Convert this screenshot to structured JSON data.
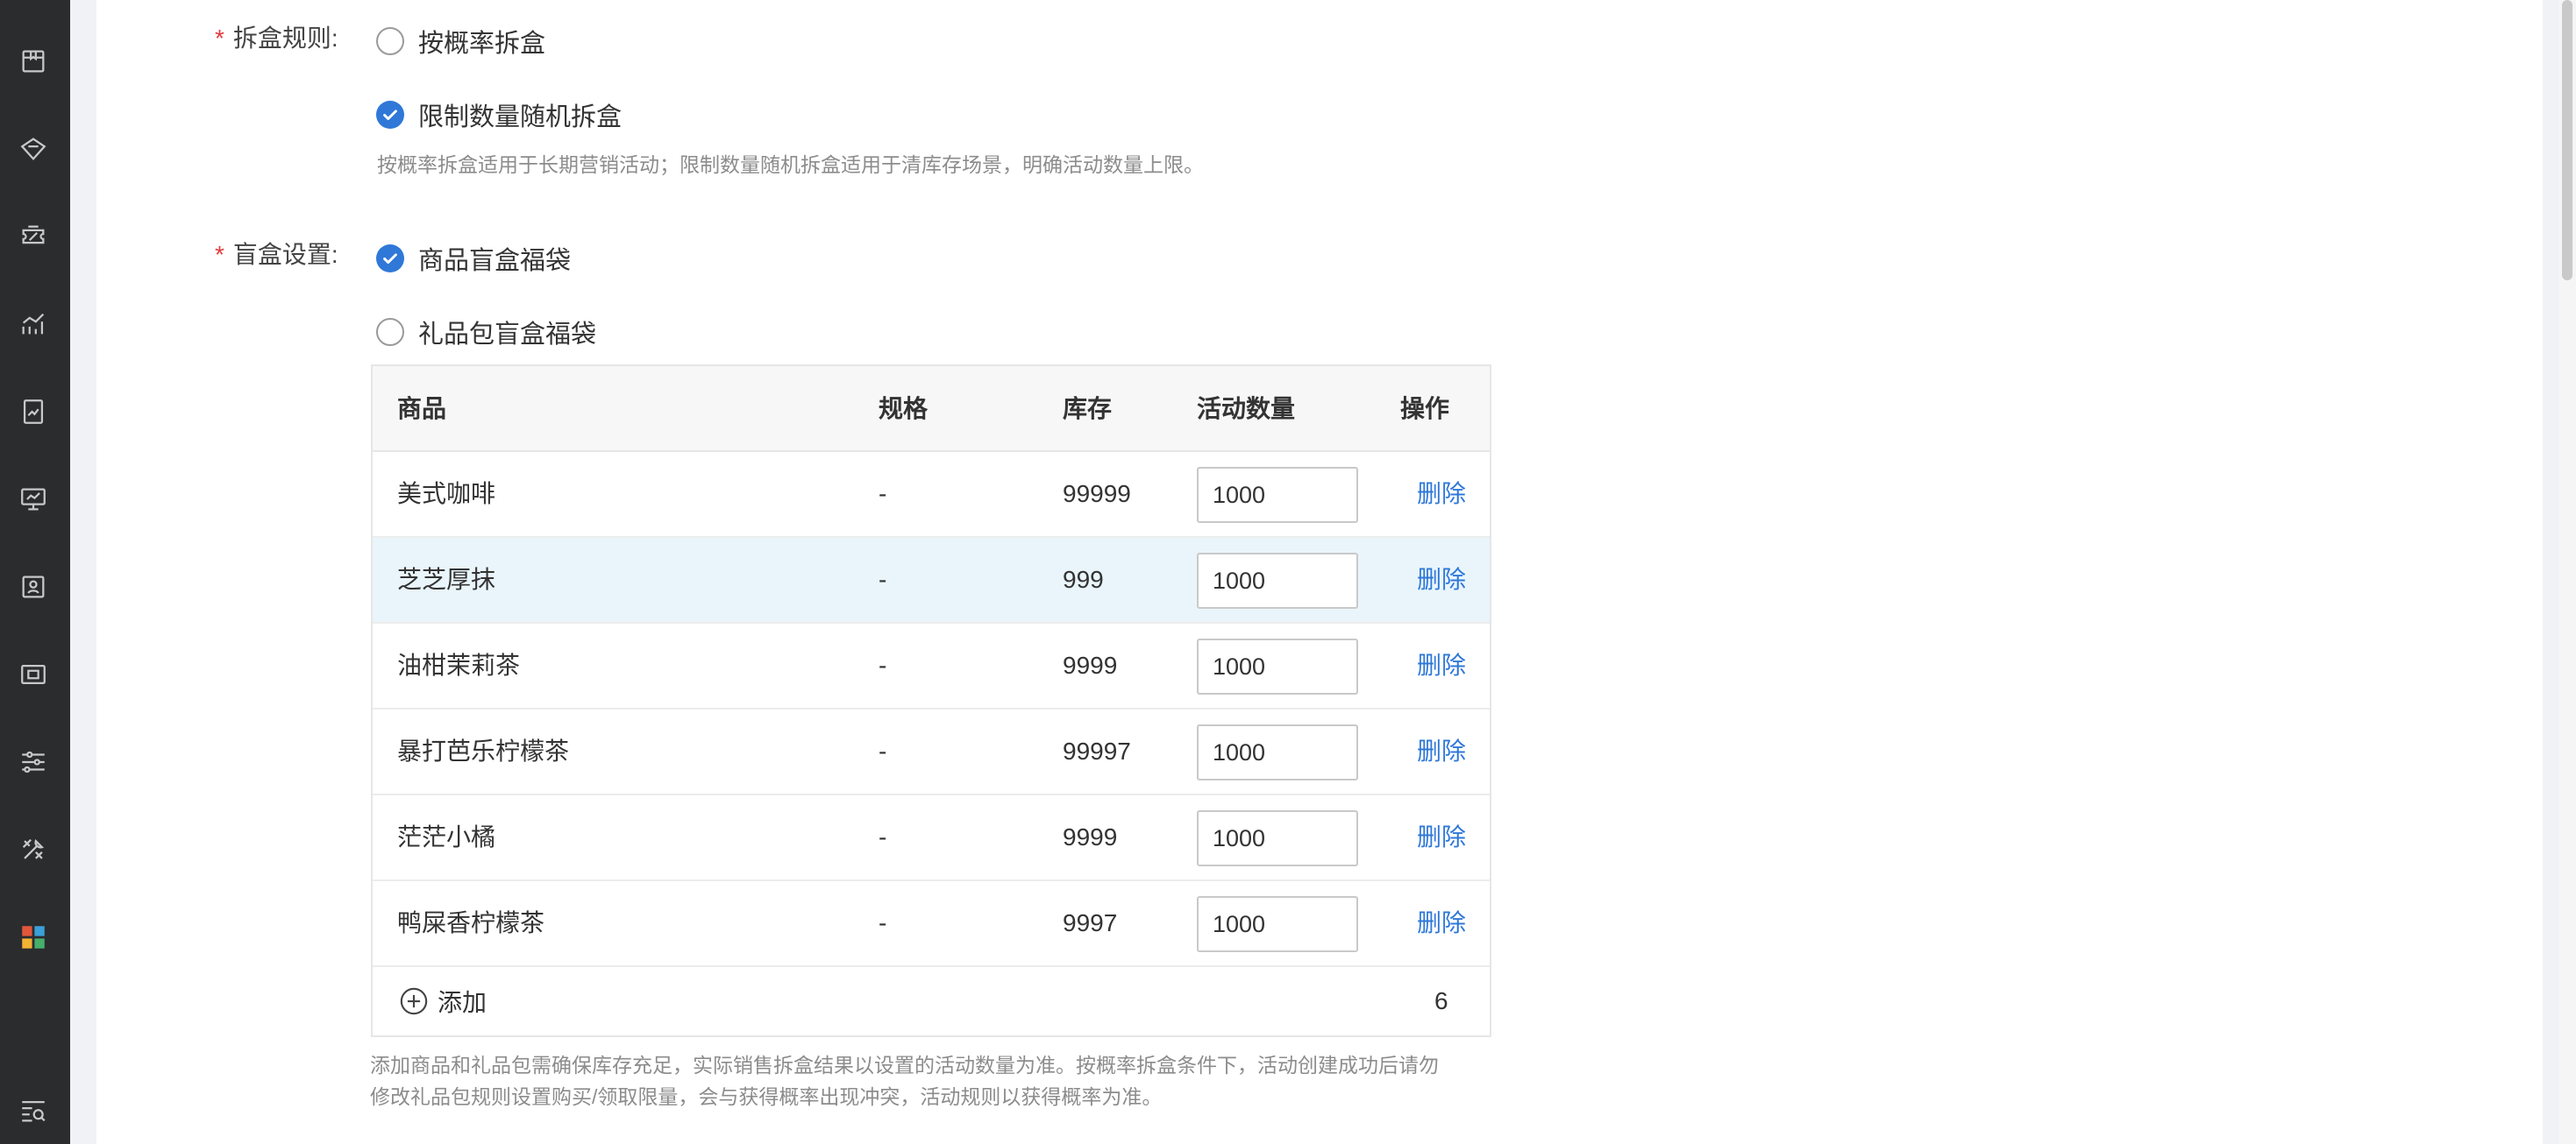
{
  "sidebar": {
    "icons": [
      "package-icon",
      "diamond-icon",
      "coupon-icon",
      "line-chart-icon",
      "report-icon",
      "monitor-chart-icon",
      "id-card-icon",
      "ticket-icon",
      "sliders-icon",
      "tools-icon",
      "apps-icon",
      "search-list-icon"
    ]
  },
  "rule": {
    "label": "拆盒规则:",
    "required_mark": "*",
    "options": [
      {
        "label": "按概率拆盒",
        "checked": false
      },
      {
        "label": "限制数量随机拆盒",
        "checked": true
      }
    ],
    "hint": "按概率拆盒适用于长期营销活动；限制数量随机拆盒适用于清库存场景，明确活动数量上限。"
  },
  "setting": {
    "label": "盲盒设置:",
    "required_mark": "*",
    "options": [
      {
        "label": "商品盲盒福袋",
        "checked": true
      },
      {
        "label": "礼品包盲盒福袋",
        "checked": false
      }
    ]
  },
  "table": {
    "headers": [
      "商品",
      "规格",
      "库存",
      "活动数量",
      "操作"
    ],
    "rows": [
      {
        "product": "美式咖啡",
        "spec": "-",
        "stock": "99999",
        "qty": "1000",
        "action": "删除"
      },
      {
        "product": "芝芝厚抹",
        "spec": "-",
        "stock": "999",
        "qty": "1000",
        "action": "删除"
      },
      {
        "product": "油柑茉莉茶",
        "spec": "-",
        "stock": "9999",
        "qty": "1000",
        "action": "删除"
      },
      {
        "product": "暴打芭乐柠檬茶",
        "spec": "-",
        "stock": "99997",
        "qty": "1000",
        "action": "删除"
      },
      {
        "product": "茫茫小橘",
        "spec": "-",
        "stock": "9999",
        "qty": "1000",
        "action": "删除"
      },
      {
        "product": "鸭屎香柠檬茶",
        "spec": "-",
        "stock": "9997",
        "qty": "1000",
        "action": "删除"
      }
    ],
    "add_label": "添加",
    "count": "6"
  },
  "bottom_hint": {
    "line1": "添加商品和礼品包需确保库存充足，实际销售拆盒结果以设置的活动数量为准。按概率拆盒条件下，活动创建成功后请勿",
    "line2": "修改礼品包规则设置购买/领取限量，会与获得概率出现冲突，活动规则以获得概率为准。"
  },
  "colors": {
    "sidebar_bg": "#2b2c2e",
    "accent": "#2f78d8",
    "required": "#e23b3b",
    "highlight_row": "#e9f5fb"
  }
}
